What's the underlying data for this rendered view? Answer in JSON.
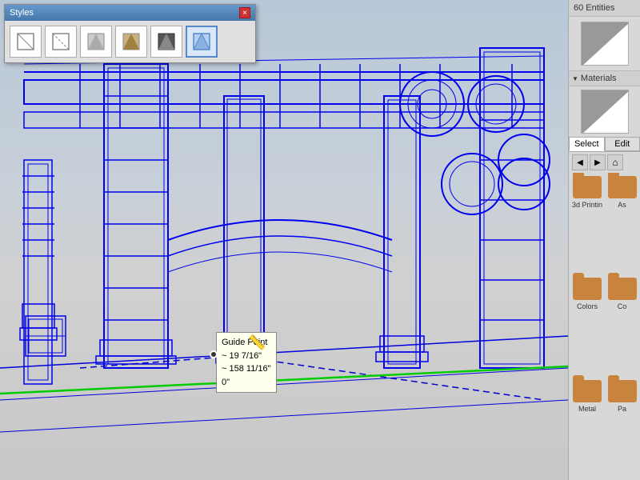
{
  "styles_window": {
    "title": "Styles",
    "close_label": "×",
    "icons": [
      {
        "name": "wireframe-style",
        "label": "wireframe"
      },
      {
        "name": "hidden-line-style",
        "label": "hidden-line"
      },
      {
        "name": "shaded-style",
        "label": "shaded"
      },
      {
        "name": "shaded-texture-style",
        "label": "shaded-texture"
      },
      {
        "name": "monochrome-style",
        "label": "monochrome"
      },
      {
        "name": "xray-style",
        "label": "xray",
        "active": true
      }
    ]
  },
  "right_panel": {
    "entities_count": "60 Entities",
    "materials_label": "Materials",
    "tabs": [
      "Select",
      "Edit"
    ],
    "active_tab": "Select",
    "mat_items": [
      {
        "label": "3d Printin"
      },
      {
        "label": "As"
      },
      {
        "label": "Colors"
      },
      {
        "label": "Co"
      },
      {
        "label": "Metal"
      },
      {
        "label": "Pa"
      }
    ]
  },
  "guide_tooltip": {
    "title": "Guide Point",
    "line1": "~ 19 7/16\"",
    "line2": "~ 158 11/16\"",
    "line3": "0\""
  },
  "scene": {
    "wireframe_color": "#0000ee"
  }
}
